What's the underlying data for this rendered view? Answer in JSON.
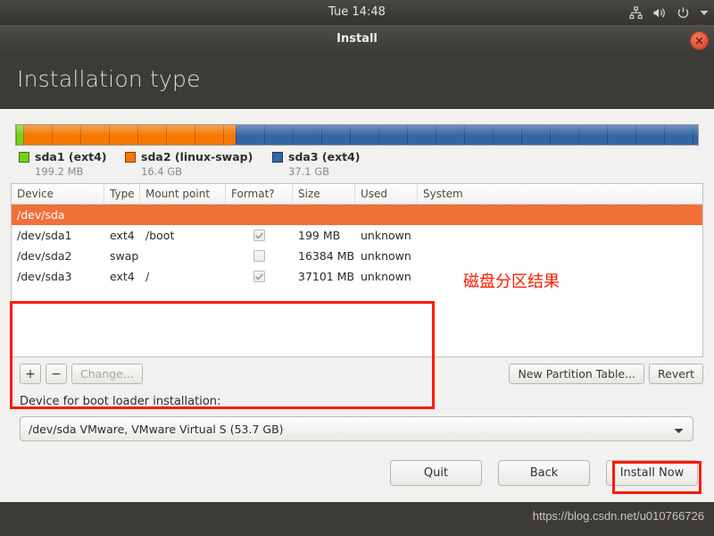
{
  "panel": {
    "clock": "Tue 14:48",
    "icons": [
      "network-icon",
      "volume-icon",
      "power-icon",
      "chevron-down-icon"
    ]
  },
  "window": {
    "title": "Install",
    "close_icon": "close-icon"
  },
  "header": {
    "title": "Installation type"
  },
  "partition_bar": {
    "segments": [
      {
        "label": "sda1",
        "color": "#73d216",
        "width_pct": 1.0
      },
      {
        "label": "sda2",
        "color": "#f57900",
        "width_pct": 31.2
      },
      {
        "label": "sda3",
        "color": "#3465a4",
        "width_pct": 67.8
      }
    ],
    "legend": [
      {
        "name": "sda1 (ext4)",
        "size": "199.2 MB",
        "color": "#73d216"
      },
      {
        "name": "sda2 (linux-swap)",
        "size": "16.4 GB",
        "color": "#f57900"
      },
      {
        "name": "sda3 (ext4)",
        "size": "37.1 GB",
        "color": "#3465a4"
      }
    ]
  },
  "table": {
    "columns": [
      "Device",
      "Type",
      "Mount point",
      "Format?",
      "Size",
      "Used",
      "System"
    ],
    "rows": [
      {
        "selected": true,
        "device": "/dev/sda",
        "type": "",
        "mount_point": "",
        "format": null,
        "size": "",
        "used": "",
        "system": ""
      },
      {
        "selected": false,
        "device": "/dev/sda1",
        "type": "ext4",
        "mount_point": "/boot",
        "format": true,
        "size": "199 MB",
        "used": "unknown",
        "system": ""
      },
      {
        "selected": false,
        "device": "/dev/sda2",
        "type": "swap",
        "mount_point": "",
        "format": false,
        "size": "16384 MB",
        "used": "unknown",
        "system": ""
      },
      {
        "selected": false,
        "device": "/dev/sda3",
        "type": "ext4",
        "mount_point": "/",
        "format": true,
        "size": "37101 MB",
        "used": "unknown",
        "system": ""
      }
    ]
  },
  "toolbar": {
    "add_label": "+",
    "remove_label": "−",
    "change_label": "Change...",
    "new_partition_table_label": "New Partition Table...",
    "revert_label": "Revert"
  },
  "bootloader": {
    "label": "Device for boot loader installation:",
    "selected": "/dev/sda   VMware, VMware Virtual S (53.7 GB)",
    "arrow_icon": "chevron-down-icon"
  },
  "nav": {
    "quit_label": "Quit",
    "back_label": "Back",
    "install_label": "Install Now"
  },
  "annotations": {
    "table_note": "磁盘分区结果",
    "highlight_color": "#ff1a00"
  },
  "footer": {
    "watermark": "https://blog.csdn.net/u010766726"
  }
}
